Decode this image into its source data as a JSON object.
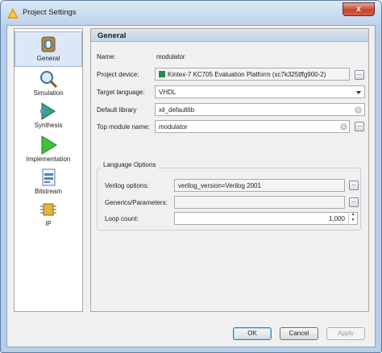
{
  "window": {
    "title": "Project Settings",
    "close_glyph": "x"
  },
  "sidebar": {
    "items": [
      {
        "label": "General",
        "icon": "general-settings-icon",
        "selected": true
      },
      {
        "label": "Simulation",
        "icon": "magnifier-icon",
        "selected": false
      },
      {
        "label": "Synthesis",
        "icon": "synthesis-icon",
        "selected": false
      },
      {
        "label": "Implementation",
        "icon": "play-triangle-icon",
        "selected": false
      },
      {
        "label": "Bitstream",
        "icon": "bitstream-file-icon",
        "selected": false
      },
      {
        "label": "IP",
        "icon": "ip-chip-icon",
        "selected": false
      }
    ]
  },
  "general": {
    "header": "General",
    "name_label": "Name:",
    "name_value": "modulator",
    "device_label": "Project device:",
    "device_value": "Kintex-7 KC705 Evaluation Platform (xc7k325tffg900-2)",
    "language_label": "Target language:",
    "language_value": "VHDL",
    "library_label": "Default library",
    "library_value": "xil_defaultlib",
    "top_label": "Top module name:",
    "top_value": "modulator",
    "browse_glyph": "...",
    "clear_glyph": "x"
  },
  "language_options": {
    "title": "Language Options",
    "verilog_label": "Verilog options:",
    "verilog_value": "verilog_version=Verilog 2001",
    "generics_label": "Generics/Parameters:",
    "generics_value": "",
    "loop_label": "Loop count:",
    "loop_value": "1,000"
  },
  "buttons": {
    "ok": "OK",
    "cancel": "Cancel",
    "apply": "Apply"
  },
  "colors": {
    "accent": "#2b8a3e",
    "selection": "#dce8f7"
  }
}
